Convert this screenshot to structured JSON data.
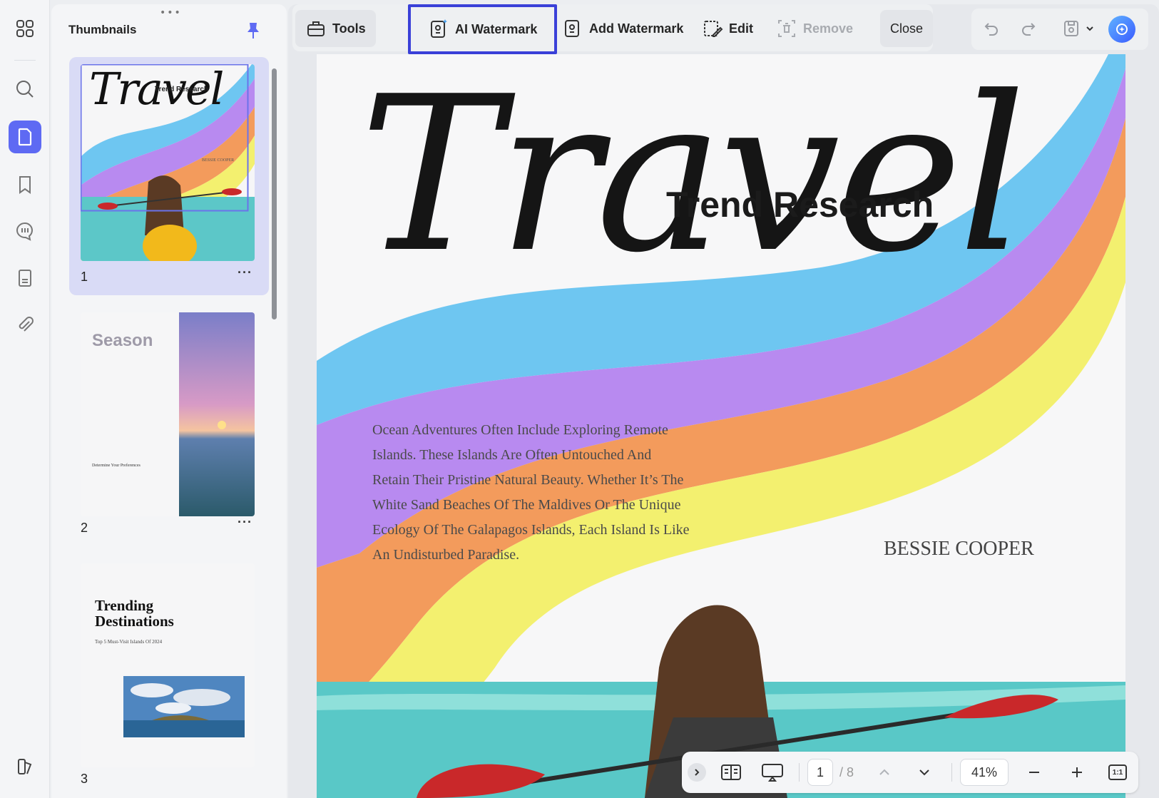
{
  "rail": {
    "items": [
      "apps-icon",
      "search-icon",
      "pages-icon",
      "bookmark-icon",
      "comments-icon",
      "form-icon",
      "attachment-icon",
      "theme-icon"
    ]
  },
  "thumbnails": {
    "title": "Thumbnails",
    "pages": [
      {
        "number": "1",
        "caption_title": "Travel",
        "caption_sub": "Trend Research",
        "author": "BESSIE COOPER"
      },
      {
        "number": "2",
        "caption_title": "Season",
        "sub_heading": "Determine Your Preferences"
      },
      {
        "number": "3",
        "caption_title": "Trending Destinations",
        "caption_sub": "Top 5 Must-Visit Islands Of 2024"
      }
    ]
  },
  "toolbar": {
    "tools": "Tools",
    "ai_watermark": "AI Watermark",
    "add_watermark": "Add Watermark",
    "edit": "Edit",
    "remove": "Remove",
    "close": "Close"
  },
  "document": {
    "title_script": "Travel",
    "subtitle": "Trend Research",
    "body_lines": [
      "Ocean Adventures Often Include Exploring Remote",
      "Islands. These Islands Are Often Untouched And",
      "Retain Their Pristine Natural Beauty. Whether It’s The",
      "White Sand Beaches Of The Maldives Or The Unique",
      "Ecology Of The Galapagos Islands, Each Island Is Like",
      "An Undisturbed Paradise."
    ],
    "author": "BESSIE COOPER"
  },
  "pager": {
    "current_page": "1",
    "total": "/ 8",
    "zoom": "41%",
    "fit_label": "1:1"
  },
  "colors": {
    "accent": "#5e6af3",
    "highlight_border": "#3a40d8",
    "stripe_blue": "#6ec6f1",
    "stripe_purple": "#b88af0",
    "stripe_orange": "#f39b5c",
    "stripe_yellow": "#f3f06f",
    "sea": "#59c8c7"
  }
}
